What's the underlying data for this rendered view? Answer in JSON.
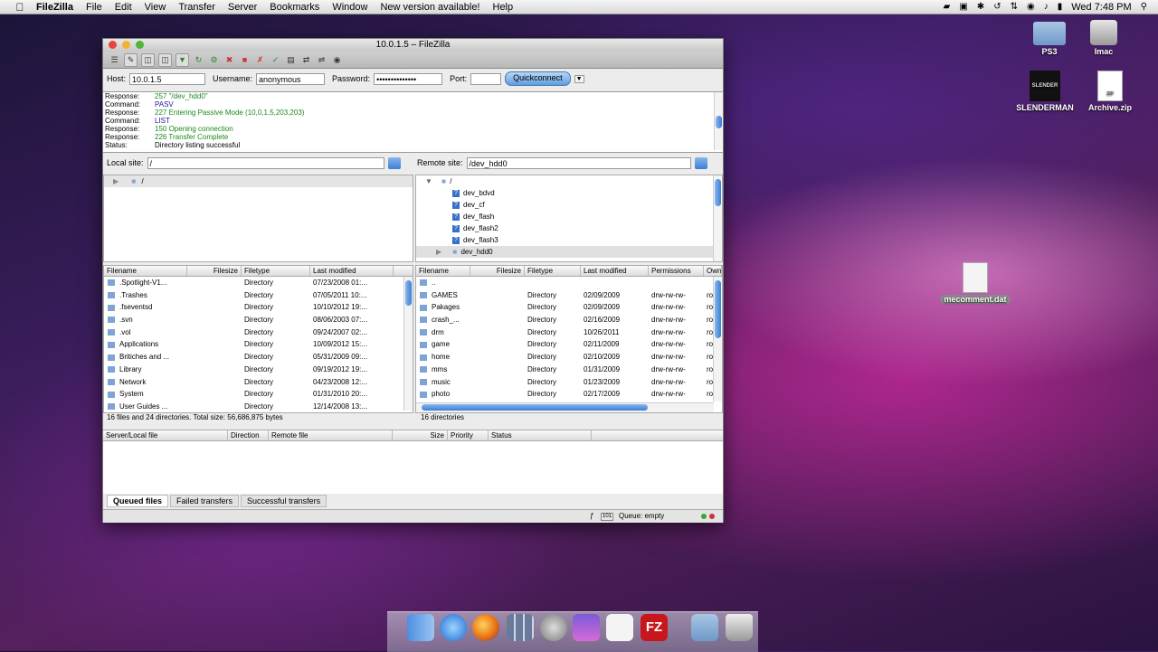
{
  "menubar": {
    "app": "FileZilla",
    "items": [
      "File",
      "Edit",
      "View",
      "Transfer",
      "Server",
      "Bookmarks",
      "Window",
      "New version available!",
      "Help"
    ],
    "clock": "Wed 7:48 PM"
  },
  "desktop": {
    "icons": [
      {
        "label": "PS3",
        "icon": "folder-icon"
      },
      {
        "label": "Imac",
        "icon": "drive-icon"
      },
      {
        "label": "SLENDERMAN",
        "icon": "picture-icon",
        "art": "SLENDER"
      },
      {
        "label": "Archive.zip",
        "icon": "zip-icon",
        "art": "ZIP"
      },
      {
        "label": "mecomment.dat",
        "icon": "document-icon"
      }
    ]
  },
  "window": {
    "title": "10.0.1.5 – FileZilla",
    "quickconnect": {
      "host_label": "Host:",
      "host": "10.0.1.5",
      "user_label": "Username:",
      "user": "anonymous",
      "pass_label": "Password:",
      "pass": "••••••••••••••",
      "port_label": "Port:",
      "port": "",
      "button": "Quickconnect"
    },
    "log": [
      {
        "type": "Response:",
        "msg": "257 \"/dev_hdd0\"",
        "color": "green"
      },
      {
        "type": "Command:",
        "msg": "PASV",
        "color": "blue"
      },
      {
        "type": "Response:",
        "msg": "227 Entering Passive Mode (10,0,1,5,203,203)",
        "color": "green"
      },
      {
        "type": "Command:",
        "msg": "LIST",
        "color": "blue"
      },
      {
        "type": "Response:",
        "msg": "150 Opening connection",
        "color": "green"
      },
      {
        "type": "Response:",
        "msg": "226 Transfer Complete",
        "color": "green"
      },
      {
        "type": "Status:",
        "msg": "Directory listing successful",
        "color": "black"
      }
    ],
    "local": {
      "label": "Local site:",
      "path": "/",
      "tree": [
        "/"
      ],
      "columns": [
        "Filename",
        "Filesize",
        "Filetype",
        "Last modified"
      ],
      "files": [
        {
          "name": ".Spotlight-V1...",
          "size": "",
          "type": "Directory",
          "modified": "07/23/2008 01:..."
        },
        {
          "name": ".Trashes",
          "size": "",
          "type": "Directory",
          "modified": "07/05/2011 10:..."
        },
        {
          "name": ".fseventsd",
          "size": "",
          "type": "Directory",
          "modified": "10/10/2012 19:..."
        },
        {
          "name": ".svn",
          "size": "",
          "type": "Directory",
          "modified": "08/06/2003 07:..."
        },
        {
          "name": ".vol",
          "size": "",
          "type": "Directory",
          "modified": "09/24/2007 02:..."
        },
        {
          "name": "Applications",
          "size": "",
          "type": "Directory",
          "modified": "10/09/2012 15:..."
        },
        {
          "name": "Britiches and ...",
          "size": "",
          "type": "Directory",
          "modified": "05/31/2009 09:..."
        },
        {
          "name": "Library",
          "size": "",
          "type": "Directory",
          "modified": "09/19/2012 19:..."
        },
        {
          "name": "Network",
          "size": "",
          "type": "Directory",
          "modified": "04/23/2008 12:..."
        },
        {
          "name": "System",
          "size": "",
          "type": "Directory",
          "modified": "01/31/2010 20:..."
        },
        {
          "name": "User Guides ...",
          "size": "",
          "type": "Directory",
          "modified": "12/14/2008 13:..."
        }
      ],
      "status": "16 files and 24 directories. Total size: 56,686,875 bytes"
    },
    "remote": {
      "label": "Remote site:",
      "path": "/dev_hdd0",
      "tree": [
        "/",
        "dev_bdvd",
        "dev_cf",
        "dev_flash",
        "dev_flash2",
        "dev_flash3",
        "dev_hdd0"
      ],
      "columns": [
        "Filename",
        "Filesize",
        "Filetype",
        "Last modified",
        "Permissions",
        "Own"
      ],
      "files": [
        {
          "name": "..",
          "size": "",
          "type": "",
          "modified": "",
          "perm": "",
          "own": ""
        },
        {
          "name": "GAMES",
          "size": "",
          "type": "Directory",
          "modified": "02/09/2009",
          "perm": "drw-rw-rw-",
          "own": "ro"
        },
        {
          "name": "Pakages",
          "size": "",
          "type": "Directory",
          "modified": "02/09/2009",
          "perm": "drw-rw-rw-",
          "own": "ro"
        },
        {
          "name": "crash_...",
          "size": "",
          "type": "Directory",
          "modified": "02/16/2009",
          "perm": "drw-rw-rw-",
          "own": "ro"
        },
        {
          "name": "drm",
          "size": "",
          "type": "Directory",
          "modified": "10/26/2011",
          "perm": "drw-rw-rw-",
          "own": "ro"
        },
        {
          "name": "game",
          "size": "",
          "type": "Directory",
          "modified": "02/11/2009",
          "perm": "drw-rw-rw-",
          "own": "ro"
        },
        {
          "name": "home",
          "size": "",
          "type": "Directory",
          "modified": "02/10/2009",
          "perm": "drw-rw-rw-",
          "own": "ro"
        },
        {
          "name": "mms",
          "size": "",
          "type": "Directory",
          "modified": "01/31/2009",
          "perm": "drw-rw-rw-",
          "own": "ro"
        },
        {
          "name": "music",
          "size": "",
          "type": "Directory",
          "modified": "01/23/2009",
          "perm": "drw-rw-rw-",
          "own": "ro"
        },
        {
          "name": "photo",
          "size": "",
          "type": "Directory",
          "modified": "02/17/2009",
          "perm": "drw-rw-rw-",
          "own": "ro"
        }
      ],
      "status": "16 directories"
    },
    "queue": {
      "columns": [
        "Server/Local file",
        "Direction",
        "Remote file",
        "Size",
        "Priority",
        "Status"
      ],
      "tabs": [
        "Queued files",
        "Failed transfers",
        "Successful transfers"
      ],
      "status": "Queue: empty"
    }
  },
  "dock": {
    "items": [
      "finder-icon",
      "itunes-icon",
      "firefox-icon",
      "dashboard-icon",
      "system-preferences-icon",
      "imovie-icon",
      "textedit-icon",
      "filezilla-icon",
      "documents-folder-icon",
      "trash-icon"
    ],
    "filezilla_art": "FZ"
  }
}
